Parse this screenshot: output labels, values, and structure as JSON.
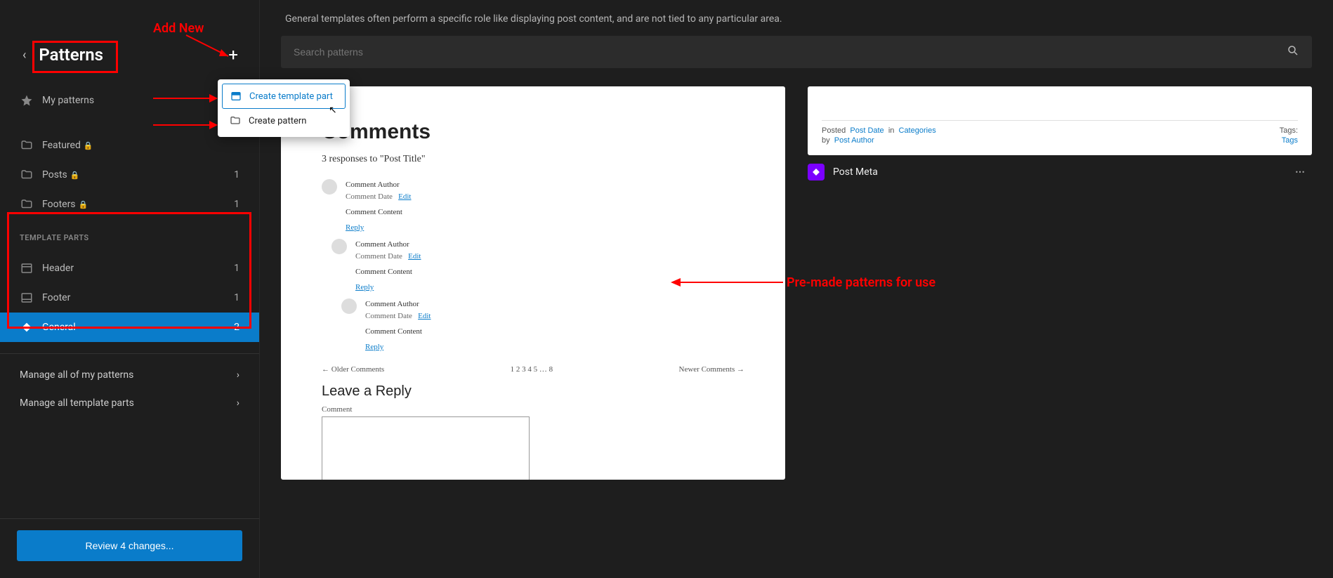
{
  "header": {
    "title": "Patterns"
  },
  "sidebar": {
    "my_patterns_label": "My patterns",
    "items_a": [
      {
        "label": "Featured",
        "locked": true,
        "count": ""
      },
      {
        "label": "Posts",
        "locked": true,
        "count": "1"
      },
      {
        "label": "Footers",
        "locked": true,
        "count": "1"
      }
    ],
    "template_parts_label": "TEMPLATE PARTS",
    "items_b": [
      {
        "label": "Header",
        "count": "1"
      },
      {
        "label": "Footer",
        "count": "1"
      },
      {
        "label": "General",
        "count": "2",
        "active": true
      }
    ],
    "manage_patterns": "Manage all of my patterns",
    "manage_template_parts": "Manage all template parts",
    "review_button": "Review 4 changes..."
  },
  "popover": {
    "create_template_part": "Create template part",
    "create_pattern": "Create pattern"
  },
  "main": {
    "description": "General templates often perform a specific role like displaying post content, and are not tied to any particular area.",
    "search_placeholder": "Search patterns"
  },
  "card_comments": {
    "heading": "Comments",
    "subheading": "3 responses to \"Post Title\"",
    "author": "Comment Author",
    "date": "Comment Date",
    "edit": "Edit",
    "content": "Comment Content",
    "reply": "Reply",
    "older": "←   Older Comments",
    "pages": "1 2 3 4 5 … 8",
    "newer": "Newer Comments   →",
    "leave_reply": "Leave a Reply",
    "comment_label": "Comment"
  },
  "card_meta": {
    "posted": "Posted",
    "post_date": "Post Date",
    "in": "in",
    "categories": "Categories",
    "by": "by",
    "post_author": "Post Author",
    "tags_label": "Tags:",
    "tags": "Tags",
    "title": "Post Meta"
  },
  "annotations": {
    "add_new": "Add New",
    "premade": "Pre-made patterns for use"
  }
}
